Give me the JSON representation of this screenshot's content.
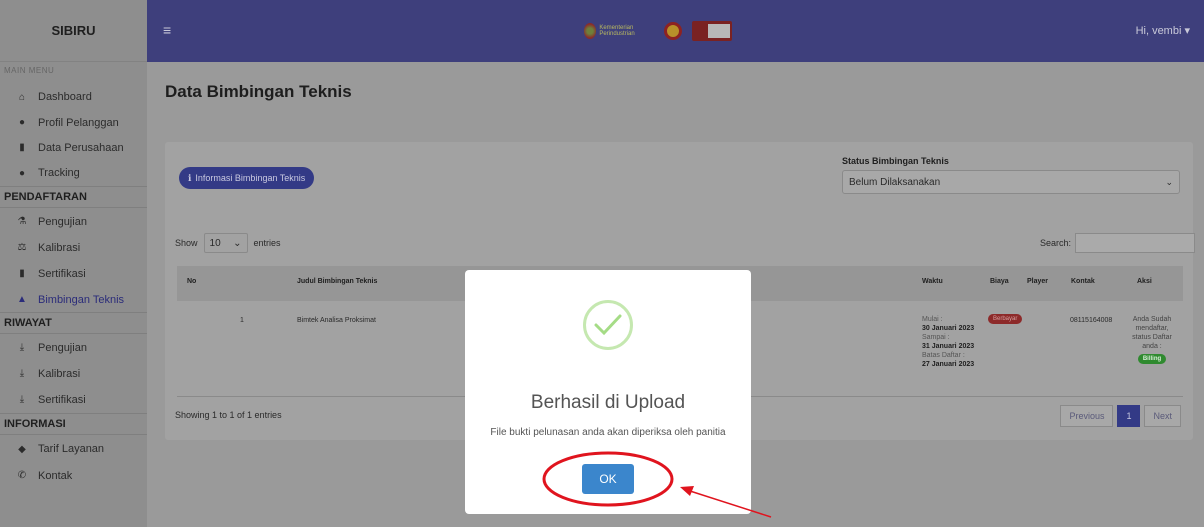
{
  "brand": "SIBIRU",
  "sidebar": {
    "main_menu_label": "MAIN MENU",
    "items": [
      {
        "label": "Dashboard",
        "icon": "home-icon"
      },
      {
        "label": "Profil Pelanggan",
        "icon": "user-icon"
      },
      {
        "label": "Data Perusahaan",
        "icon": "building-icon"
      },
      {
        "label": "Tracking",
        "icon": "pin-icon"
      }
    ],
    "pendaftaran_label": "PENDAFTARAN",
    "pendaftaran_items": [
      {
        "label": "Pengujian",
        "icon": "flask-icon"
      },
      {
        "label": "Kalibrasi",
        "icon": "scale-icon"
      },
      {
        "label": "Sertifikasi",
        "icon": "certificate-icon"
      },
      {
        "label": "Bimbingan Teknis",
        "icon": "graduation-icon"
      }
    ],
    "riwayat_label": "RIWAYAT",
    "riwayat_items": [
      {
        "label": "Pengujian",
        "icon": "download-icon"
      },
      {
        "label": "Kalibrasi",
        "icon": "download-icon"
      },
      {
        "label": "Sertifikasi",
        "icon": "download-icon"
      }
    ],
    "informasi_label": "INFORMASI",
    "informasi_items": [
      {
        "label": "Tarif Layanan",
        "icon": "tag-icon"
      },
      {
        "label": "Kontak",
        "icon": "phone-icon"
      }
    ]
  },
  "header": {
    "menu_icon": "hamburger-icon",
    "logo_text": "Kementerian Perindustrian",
    "user_greeting": "Hi, vembi"
  },
  "main": {
    "page_title": "Data Bimbingan Teknis",
    "info_button": "Informasi Bimbingan Teknis",
    "status_label": "Status Bimbingan Teknis",
    "status_value": "Belum Dilaksanakan",
    "show_label": "Show",
    "entries_value": "10",
    "entries_label": "entries",
    "search_label": "Search:",
    "columns": [
      "No",
      "Judul Bimbingan Teknis",
      "Waktu",
      "Biaya",
      "Player",
      "Kontak",
      "Aksi"
    ],
    "row": {
      "no": "1",
      "judul": "Bimtek Analisa Proksimat",
      "mulai_label": "Mulai :",
      "mulai_value": "30 Januari 2023",
      "sampai_label": "Sampai :",
      "sampai_value": "31 Januari 2023",
      "batas_label": "Batas Daftar :",
      "batas_value": "27 Januari 2023",
      "biaya_badge": "Berbayar",
      "kontak": "08115164008",
      "aksi_text": "Anda Sudah mendaftar, status Daftar anda :",
      "aksi_badge": "Billing"
    },
    "showing": "Showing 1 to 1 of 1 entries",
    "pager": {
      "previous": "Previous",
      "page": "1",
      "next": "Next"
    }
  },
  "modal": {
    "title": "Berhasil di Upload",
    "message": "File bukti pelunasan anda akan diperiksa oleh panitia",
    "ok": "OK"
  },
  "colors": {
    "accent": "#3b86cc",
    "annotation": "#e0141e",
    "success": "#a5dc86"
  }
}
